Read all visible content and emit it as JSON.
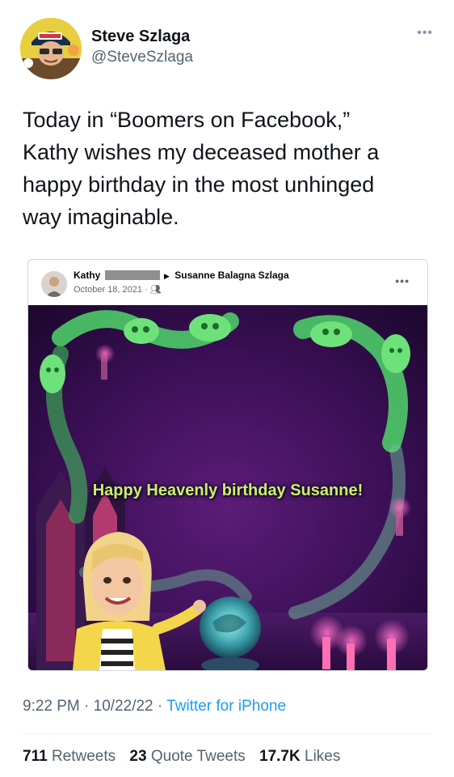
{
  "author": {
    "name": "Steve Szlaga",
    "handle": "@SteveSzlaga"
  },
  "tweet": {
    "text": "Today in “Boomers on Facebook,”\nKathy wishes my deceased mother a\nhappy birthday in the most unhinged\nway imaginable."
  },
  "fb_post": {
    "poster_name": "Kathy",
    "recipient_name": "Susanne Balagna Szlaga",
    "date": "October 18, 2021 ·",
    "audience_icon": "friends-icon",
    "image_caption": "Happy Heavenly birthday Susanne!"
  },
  "footer": {
    "time": "9:22 PM",
    "date": "10/22/22",
    "separator": " · ",
    "app": "Twitter for iPhone"
  },
  "stats": {
    "retweets": {
      "count": "711",
      "label": "Retweets"
    },
    "quotes": {
      "count": "23",
      "label": "Quote Tweets"
    },
    "likes": {
      "count": "17.7K",
      "label": "Likes"
    }
  },
  "colors": {
    "text_primary": "#0f1419",
    "text_secondary": "#536471",
    "link_blue": "#1d9bf0",
    "caption_green": "#c9f26b"
  }
}
